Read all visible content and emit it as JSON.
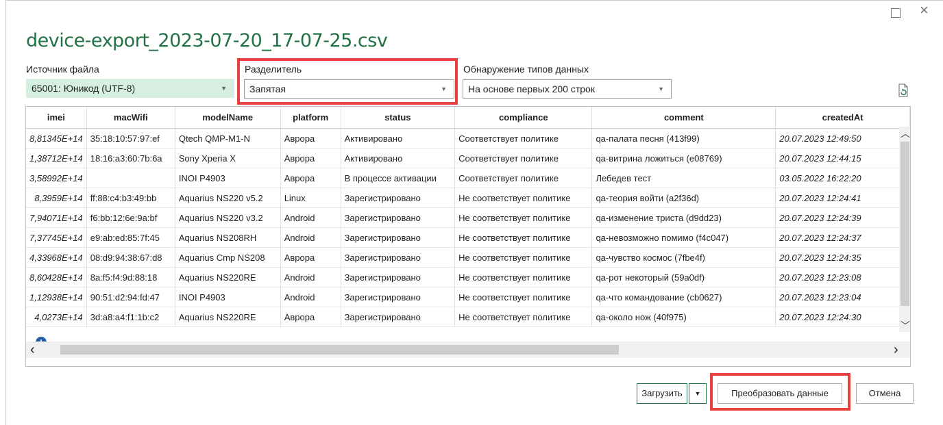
{
  "window": {
    "title": "device-export_2023-07-20_17-07-25.csv",
    "maximize_glyph": "",
    "close_glyph": "×"
  },
  "controls": {
    "file_origin": {
      "label": "Источник файла",
      "value": "65001: Юникод (UTF-8)"
    },
    "delimiter": {
      "label": "Разделитель",
      "value": "Запятая"
    },
    "type_detection": {
      "label": "Обнаружение типов данных",
      "value": "На основе первых 200 строк"
    }
  },
  "table": {
    "columns": [
      "imei",
      "macWifi",
      "modelName",
      "platform",
      "status",
      "compliance",
      "comment",
      "createdAt"
    ],
    "rows": [
      [
        "8,81345E+14",
        "35:18:10:57:97:ef",
        "Qtech QMP-M1-N",
        "Аврора",
        "Активировано",
        "Соответствует политике",
        "qa-палата песня (413f99)",
        "20.07.2023 12:49:50"
      ],
      [
        "1,38712E+14",
        "18:16:a3:60:7b:6a",
        "Sony Xperia X",
        "Аврора",
        "Активировано",
        "Соответствует политике",
        "qa-витрина ложиться (e08769)",
        "20.07.2023 12:44:15"
      ],
      [
        "3,58992E+14",
        "",
        "INOI P4903",
        "Аврора",
        "В процессе активации",
        "Соответствует политике",
        "Лебедев тест",
        "03.05.2022 16:22:20"
      ],
      [
        "8,3959E+14",
        "ff:88:c4:b3:49:bb",
        "Aquarius NS220 v5.2",
        "Linux",
        "Зарегистрировано",
        "Не соответствует политике",
        "qa-теория войти (a2f36d)",
        "20.07.2023 12:24:41"
      ],
      [
        "7,94071E+14",
        "f6:bb:12:6e:9a:bf",
        "Aquarius NS220 v3.2",
        "Android",
        "Зарегистрировано",
        "Не соответствует политике",
        "qa-изменение триста (d9dd23)",
        "20.07.2023 12:24:39"
      ],
      [
        "7,37745E+14",
        "e9:ab:ed:85:7f:45",
        "Aquarius NS208RH",
        "Android",
        "Зарегистрировано",
        "Не соответствует политике",
        "qa-невозможно помимо (f4c047)",
        "20.07.2023 12:24:37"
      ],
      [
        "4,33968E+14",
        "08:d9:94:38:67:d8",
        "Aquarius Cmp NS208",
        "Аврора",
        "Зарегистрировано",
        "Не соответствует политике",
        "qa-чувство космос (7fbe4f)",
        "20.07.2023 12:24:35"
      ],
      [
        "8,60428E+14",
        "8a:f5:f4:9d:88:18",
        "Aquarius NS220RE",
        "Android",
        "Зарегистрировано",
        "Не соответствует политике",
        "qa-рот некоторый (59a0df)",
        "20.07.2023 12:23:08"
      ],
      [
        "1,12938E+14",
        "90:51:d2:94:fd:47",
        "INOI P4903",
        "Android",
        "Зарегистрировано",
        "Не соответствует политике",
        "qa-что командование (cb0627)",
        "20.07.2023 12:23:04"
      ],
      [
        "4,0273E+14",
        "3d:a8:a4:f1:1b:c2",
        "Aquarius NS220RE",
        "Аврора",
        "Зарегистрировано",
        "Не соответствует политике",
        "qa-около нож (40f975)",
        "20.07.2023 12:24:30"
      ]
    ]
  },
  "buttons": {
    "load": "Загрузить",
    "load_dropdown": "▼",
    "transform": "Преобразовать данные",
    "cancel": "Отмена"
  },
  "colors": {
    "title_green": "#217346",
    "highlight_red": "#ea3f3f",
    "file_origin_bg": "#d6efe0"
  },
  "icons": {
    "refresh": "refresh-document-icon",
    "info": "info-icon"
  }
}
